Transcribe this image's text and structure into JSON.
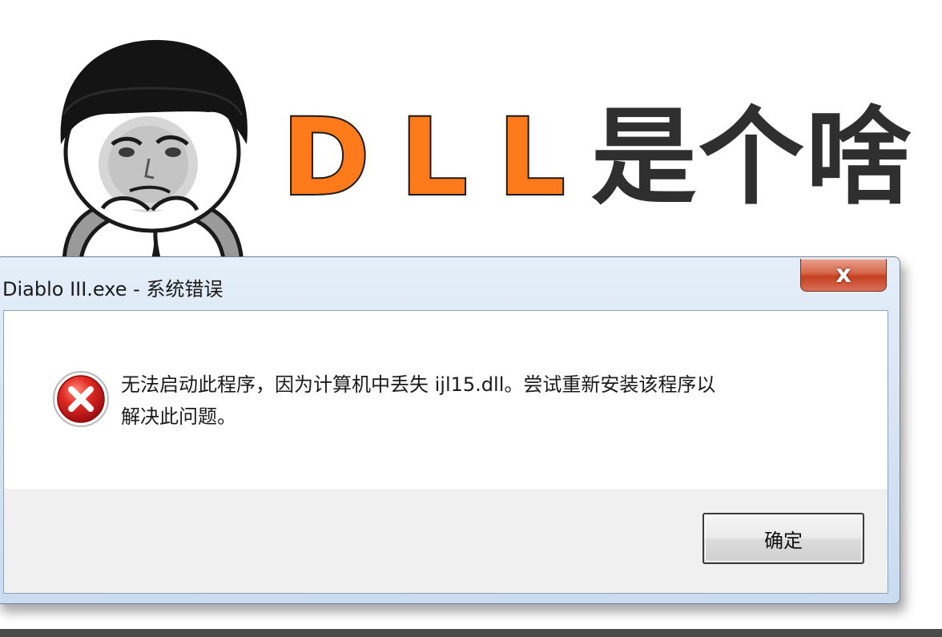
{
  "headline": {
    "dll": "DLL",
    "question": "是个啥"
  },
  "dialog": {
    "title": "Diablo III.exe - 系统错误",
    "close_glyph": "x",
    "message_line1": "无法启动此程序，因为计算机中丢失 ijl15.dll。尝试重新安装该程序以",
    "message_line2": "解决此问题。",
    "ok_label": "确定"
  },
  "icons": {
    "error": "error-icon",
    "close": "close-icon",
    "meme": "meme-face-icon"
  },
  "colors": {
    "dll_text": "#ff7a1a",
    "question_text": "#2f2f2f",
    "error_red": "#c8141b",
    "close_red": "#c4401f"
  }
}
